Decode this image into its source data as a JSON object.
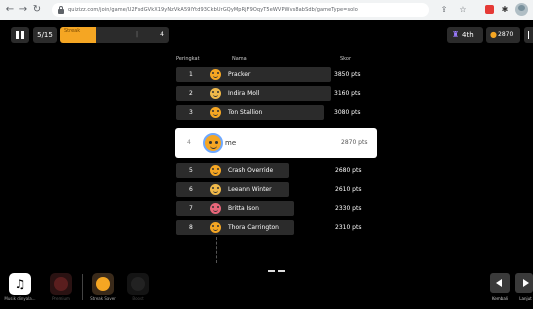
{
  "browser": {
    "url": "quizizz.com/join/game/U2FsdGVkX19yNzVkA59lYtd93CkbUrGQyMpRjF9OqyT5eWVPWvs8abSdb/gameType=solo",
    "back_icon": "arrow-left",
    "forward_icon": "arrow-right",
    "reload_icon": "reload"
  },
  "topbar": {
    "question_counter": "5/15",
    "streak_label": "Streak",
    "streak_middle": "|",
    "streak_count": "4",
    "streak_progress": 0.33,
    "rank_label": "4th",
    "score_label": "2870"
  },
  "leaderboard": {
    "header_rank": "Peringkat",
    "header_name": "Nama",
    "header_score": "Skor",
    "rows_top": [
      {
        "rank": "1",
        "name": "Pracker",
        "score": "3850 pts",
        "avatar_color": "#f5a623"
      },
      {
        "rank": "2",
        "name": "Indira Moll",
        "score": "3160 pts",
        "avatar_color": "#f0b94a"
      },
      {
        "rank": "3",
        "name": "Ton Stallion",
        "score": "3080 pts",
        "avatar_color": "#f5a623"
      }
    ],
    "me": {
      "rank": "4",
      "name": "me",
      "score": "2870 pts"
    },
    "rows_bottom": [
      {
        "rank": "5",
        "name": "Crash Override",
        "score": "2680 pts",
        "avatar_color": "#f5a623"
      },
      {
        "rank": "6",
        "name": "Leeann Winter",
        "score": "2610 pts",
        "avatar_color": "#f0b94a"
      },
      {
        "rank": "7",
        "name": "Britta Ison",
        "score": "2330 pts",
        "avatar_color": "#e8667a"
      },
      {
        "rank": "8",
        "name": "Thora Carrington",
        "score": "2310 pts",
        "avatar_color": "#f5a623"
      }
    ]
  },
  "bottombar": {
    "powerup_music_label": "Musik dinyala...",
    "powerup_2_label": "Premium",
    "powerup_3_label": "Streak Saver",
    "powerup_4_label": "Boost",
    "nav_back_label": "Kembali",
    "nav_next_label": "Lanjut"
  },
  "colors": {
    "accent": "#f5a623",
    "row_bg": "#2b2b2b",
    "me_bg": "#ffffff"
  }
}
